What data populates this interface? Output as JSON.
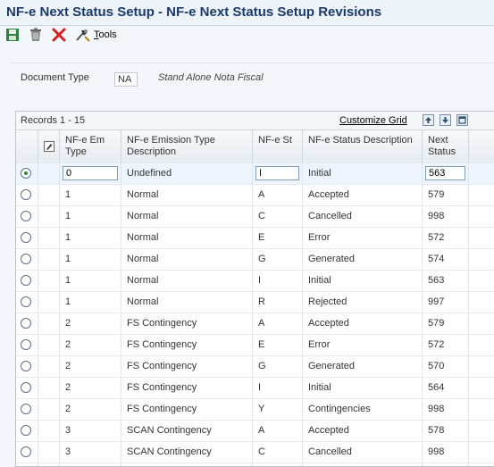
{
  "window": {
    "title": "NF-e Next Status Setup - NF-e Next Status Setup Revisions"
  },
  "toolbar": {
    "tools_label": "Tools",
    "tools_underlined": "T",
    "tools_rest": "ools"
  },
  "header": {
    "document_type_label": "Document Type",
    "document_type_value": "NA",
    "document_type_description": "Stand Alone Nota Fiscal"
  },
  "grid": {
    "records_label": "Records 1 - 15",
    "customize_label": "Customize Grid",
    "columns": {
      "em_type": "NF-e Em Type",
      "em_desc": "NF-e Emission Type Description",
      "st": "NF-e St",
      "st_desc": "NF-e Status Description",
      "next": "Next Status"
    },
    "rows": [
      {
        "em_type": "0",
        "em_desc": "Undefined",
        "st": "I",
        "st_desc": "Initial",
        "next": "563",
        "selected": true
      },
      {
        "em_type": "1",
        "em_desc": "Normal",
        "st": "A",
        "st_desc": "Accepted",
        "next": "579"
      },
      {
        "em_type": "1",
        "em_desc": "Normal",
        "st": "C",
        "st_desc": "Cancelled",
        "next": "998"
      },
      {
        "em_type": "1",
        "em_desc": "Normal",
        "st": "E",
        "st_desc": "Error",
        "next": "572"
      },
      {
        "em_type": "1",
        "em_desc": "Normal",
        "st": "G",
        "st_desc": "Generated",
        "next": "574"
      },
      {
        "em_type": "1",
        "em_desc": "Normal",
        "st": "I",
        "st_desc": "Initial",
        "next": "563"
      },
      {
        "em_type": "1",
        "em_desc": "Normal",
        "st": "R",
        "st_desc": "Rejected",
        "next": "997"
      },
      {
        "em_type": "2",
        "em_desc": "FS Contingency",
        "st": "A",
        "st_desc": "Accepted",
        "next": "579"
      },
      {
        "em_type": "2",
        "em_desc": "FS Contingency",
        "st": "E",
        "st_desc": "Error",
        "next": "572"
      },
      {
        "em_type": "2",
        "em_desc": "FS Contingency",
        "st": "G",
        "st_desc": "Generated",
        "next": "570"
      },
      {
        "em_type": "2",
        "em_desc": "FS Contingency",
        "st": "I",
        "st_desc": "Initial",
        "next": "564"
      },
      {
        "em_type": "2",
        "em_desc": "FS Contingency",
        "st": "Y",
        "st_desc": "Contingencies",
        "next": "998"
      },
      {
        "em_type": "3",
        "em_desc": "SCAN Contingency",
        "st": "A",
        "st_desc": "Accepted",
        "next": "578"
      },
      {
        "em_type": "3",
        "em_desc": "SCAN Contingency",
        "st": "C",
        "st_desc": "Cancelled",
        "next": "998"
      },
      {
        "em_type": "",
        "em_desc": "",
        "st": "",
        "st_desc": "",
        "next": ""
      }
    ]
  },
  "colors": {
    "title": "#1a3a6b",
    "accent_green": "#2e8b2e",
    "delete_red": "#d11f1f"
  },
  "icons": [
    "save-icon",
    "trash-icon",
    "close-icon",
    "tools-icon",
    "export-icon",
    "import-icon",
    "maximize-icon",
    "edit-column-icon"
  ]
}
